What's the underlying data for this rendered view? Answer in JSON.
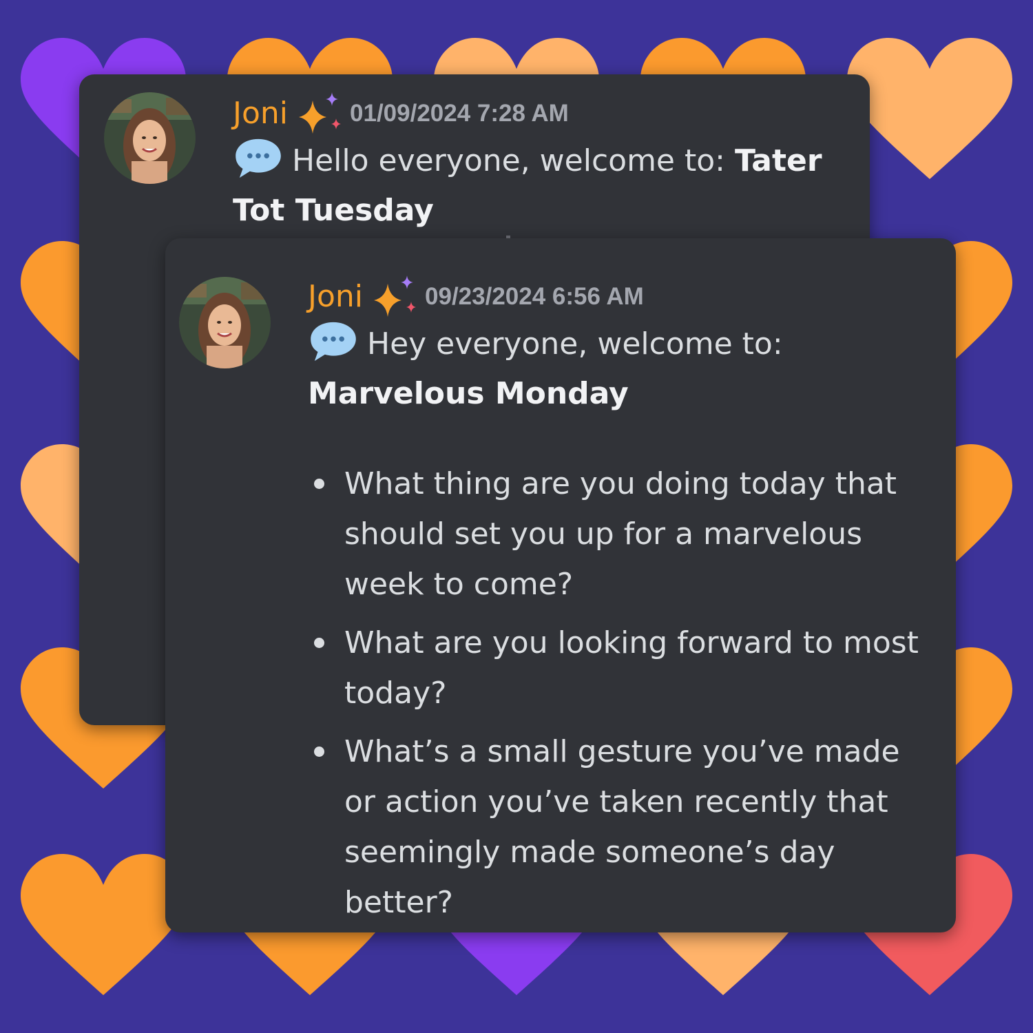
{
  "background": {
    "color": "#3d3399"
  },
  "colors": {
    "username": "#f7a02b",
    "card": "#313338",
    "timestamp": "#a4a7af",
    "text": "#dbdee1",
    "heart_orange": "#fb9a2e",
    "heart_light_orange": "#ffb36a",
    "heart_purple": "#8a3cf0",
    "heart_red": "#f15b5e"
  },
  "messages": [
    {
      "username": "Joni",
      "timestamp": "01/09/2024 7:28 AM",
      "intro": "Hello everyone, welcome to: ",
      "title": "Tater Tot Tuesday"
    },
    {
      "username": "Joni",
      "timestamp": "09/23/2024 6:56 AM",
      "intro": "Hey everyone, welcome to:",
      "title": "Marvelous Monday",
      "questions": [
        "What thing are you doing today that should set you up for a marvelous week to come?",
        "What are you looking forward to most today?",
        "What’s a small gesture you’ve made or action you’ve taken recently that seemingly made someone’s day better?"
      ]
    }
  ],
  "icons": {
    "sparkle": "sparkles-icon",
    "bubble": "speech-bubble-icon",
    "avatar": "avatar"
  }
}
